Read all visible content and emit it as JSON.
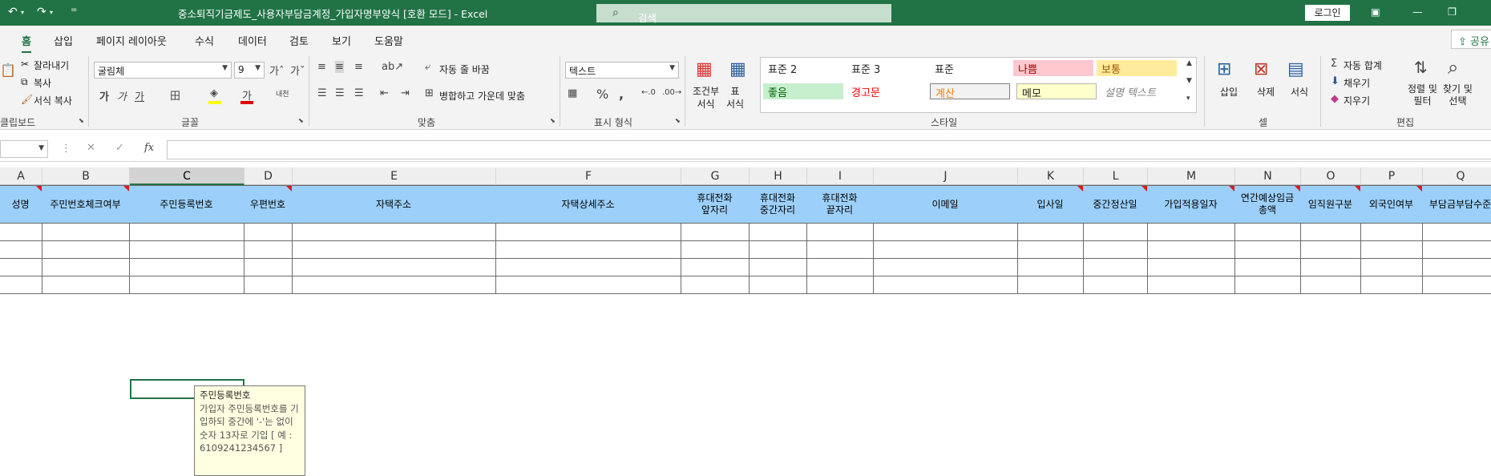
{
  "titlebar": {
    "title": "중소퇴직기금제도_사용자부담금계정_가입자명부양식 [호환 모드] - Excel",
    "search_placeholder": "검색",
    "login": "로그인"
  },
  "tabs": [
    "홈",
    "삽입",
    "페이지 레이아웃",
    "수식",
    "데이터",
    "검토",
    "보기",
    "도움말"
  ],
  "share": "공유",
  "clipboard": {
    "cut": "잘라내기",
    "copy": "복사",
    "format_painter": "서식 복사",
    "paste": "붙여넣기",
    "group": "클립보드"
  },
  "font": {
    "name": "굴림체",
    "size": "9",
    "group": "글꼴"
  },
  "alignment": {
    "wrap": "자동 줄 바꿈",
    "merge": "병합하고 가운데 맞춤",
    "group": "맞춤"
  },
  "number": {
    "format": "텍스트",
    "group": "표시 형식"
  },
  "styles": {
    "cond": "조건부\n서식",
    "table": "표\n서식",
    "group": "스타일",
    "cells": [
      {
        "label": "표준 2",
        "bg": "#ffffff",
        "fg": "#000000"
      },
      {
        "label": "표준 3",
        "bg": "#ffffff",
        "fg": "#000000"
      },
      {
        "label": "표준",
        "bg": "#ffffff",
        "fg": "#000000"
      },
      {
        "label": "나쁨",
        "bg": "#ffc7ce",
        "fg": "#9c0006"
      },
      {
        "label": "보통",
        "bg": "#ffeb9c",
        "fg": "#9c5700"
      },
      {
        "label": "좋음",
        "bg": "#c6efce",
        "fg": "#006100"
      },
      {
        "label": "경고문",
        "bg": "#ffffff",
        "fg": "#ff0000"
      },
      {
        "label": "계산",
        "bg": "#f2f2f2",
        "fg": "#fa7d00"
      },
      {
        "label": "메모",
        "bg": "#ffffcc",
        "fg": "#000000"
      },
      {
        "label": "설명 텍스트",
        "bg": "#ffffff",
        "fg": "#7f7f7f"
      }
    ]
  },
  "cells_group": {
    "insert": "삽입",
    "delete": "삭제",
    "format": "서식",
    "group": "셀"
  },
  "editing": {
    "autosum": "자동 합계",
    "fill": "채우기",
    "clear": "지우기",
    "sort": "정렬 및\n필터",
    "find": "찾기 및\n선택",
    "group": "편집"
  },
  "formula": {
    "fx": "fx",
    "value": ""
  },
  "columns": [
    "A",
    "B",
    "C",
    "D",
    "E",
    "F",
    "G",
    "H",
    "I",
    "J",
    "K",
    "L",
    "M",
    "N",
    "O",
    "P",
    "Q"
  ],
  "headers": [
    "성명",
    "주민번호체크여부",
    "주민등록번호",
    "우편번호",
    "자택주소",
    "자택상세주소",
    "휴대전화\n앞자리",
    "휴대전화\n중간자리",
    "휴대전화\n끝자리",
    "이메일",
    "입사일",
    "중간정산일",
    "가입적용일자",
    "연간예상임금\n총액",
    "임직원구분",
    "외국인여부",
    "부담금부담수준"
  ],
  "tooltip": {
    "title": "주민등록번호",
    "body": "가입자 주민등록번호를 기입하되 중간에 '-'는 없이 숫자 13자로 기입\n[ 예 : 6109241234567 ]"
  }
}
